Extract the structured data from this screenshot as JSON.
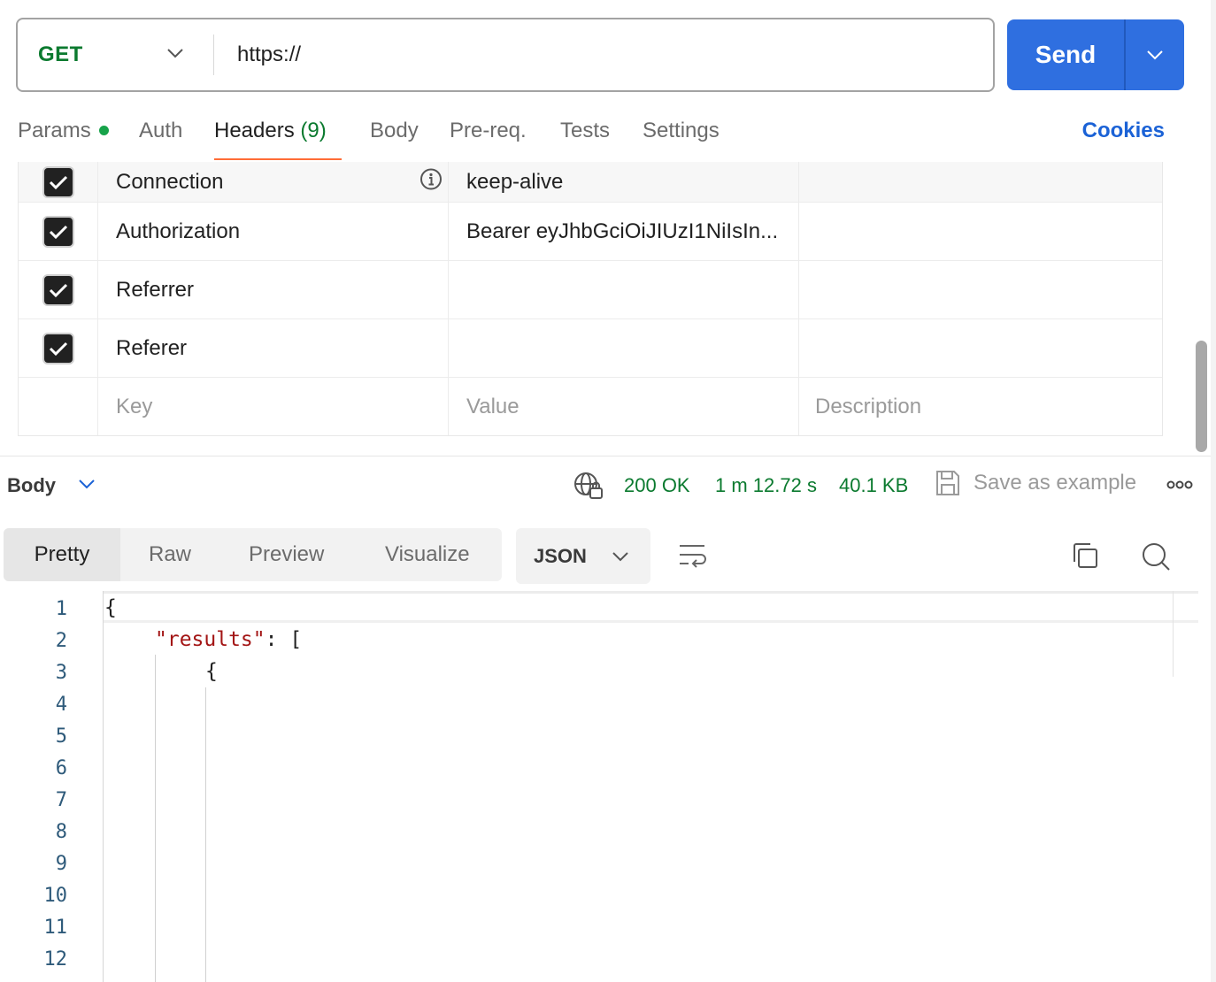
{
  "request": {
    "method": "GET",
    "url": "https://",
    "send_label": "Send"
  },
  "tabs": {
    "params": "Params",
    "auth": "Auth",
    "headers": "Headers",
    "headers_count": "(9)",
    "body": "Body",
    "prereq": "Pre-req.",
    "tests": "Tests",
    "settings": "Settings",
    "cookies": "Cookies"
  },
  "headers_rows": [
    {
      "key": "Connection",
      "value": "keep-alive",
      "checked": true
    },
    {
      "key": "Authorization",
      "value": "Bearer eyJhbGciOiJIUzI1NiIsIn...",
      "checked": true
    },
    {
      "key": "Referrer",
      "value": "",
      "checked": true
    },
    {
      "key": "Referer",
      "value": "",
      "checked": true
    }
  ],
  "headers_new": {
    "key_placeholder": "Key",
    "value_placeholder": "Value",
    "description_placeholder": "Description"
  },
  "response": {
    "body_label": "Body",
    "status": "200 OK",
    "time": "1 m 12.72 s",
    "size": "40.1 KB",
    "save_example": "Save as example"
  },
  "views": {
    "pretty": "Pretty",
    "raw": "Raw",
    "preview": "Preview",
    "visualize": "Visualize",
    "format": "JSON"
  },
  "editor": {
    "line_numbers": [
      "1",
      "2",
      "3",
      "4",
      "5",
      "6",
      "7",
      "8",
      "9",
      "10",
      "11",
      "12"
    ],
    "line1": "{",
    "line2_key": "\"results\"",
    "line2_rest": ": [",
    "line3": "{"
  },
  "colors": {
    "accent": "#2f6fe0",
    "method_green": "#0b7a2f",
    "tab_underline": "#ff6c37",
    "link_blue": "#1b62d6"
  }
}
